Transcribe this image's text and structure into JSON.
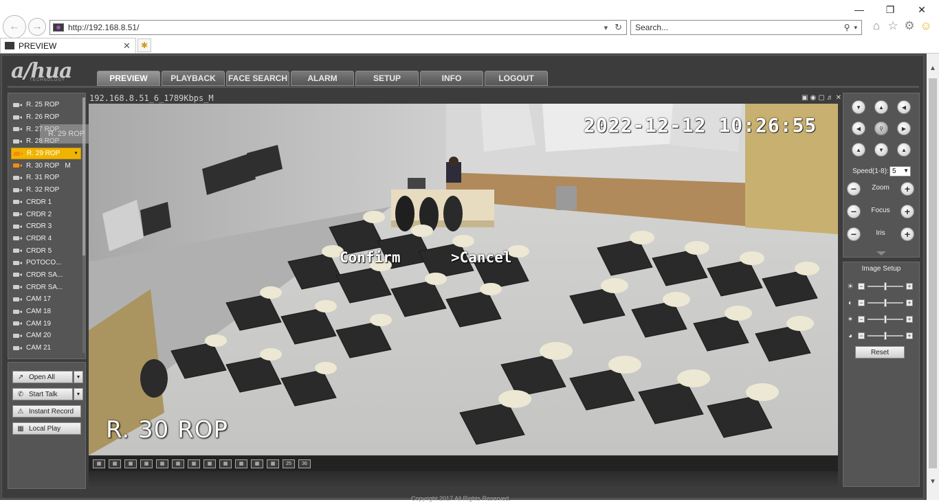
{
  "browser": {
    "address": "http://192.168.8.51/",
    "search_placeholder": "Search...",
    "tab_title": "PREVIEW"
  },
  "app": {
    "logo": "a/hua",
    "logo_sub": "TECHNOLOGY",
    "nav": [
      "PREVIEW",
      "PLAYBACK",
      "FACE SEARCH",
      "ALARM",
      "SETUP",
      "INFO",
      "LOGOUT"
    ],
    "active_nav": "PREVIEW"
  },
  "cameras": [
    {
      "label": "R. 25 ROP",
      "state": "normal"
    },
    {
      "label": "R. 26 ROP",
      "state": "normal"
    },
    {
      "label": "R. 27 ROP",
      "state": "normal"
    },
    {
      "label": "R. 28 ROP",
      "state": "normal"
    },
    {
      "label": "R. 29 ROP",
      "state": "selected"
    },
    {
      "label": "R. 30 ROP",
      "state": "active",
      "flag": "M"
    },
    {
      "label": "R. 31 ROP",
      "state": "normal"
    },
    {
      "label": "R. 32 ROP",
      "state": "normal"
    },
    {
      "label": "CRDR 1",
      "state": "normal"
    },
    {
      "label": "CRDR 2",
      "state": "normal"
    },
    {
      "label": "CRDR 3",
      "state": "normal"
    },
    {
      "label": "CRDR 4",
      "state": "normal"
    },
    {
      "label": "CRDR 5",
      "state": "normal"
    },
    {
      "label": "POTOCO...",
      "state": "normal"
    },
    {
      "label": "CRDR SA...",
      "state": "normal"
    },
    {
      "label": "CRDR SA...",
      "state": "normal"
    },
    {
      "label": "CAM 17",
      "state": "normal"
    },
    {
      "label": "CAM 18",
      "state": "normal"
    },
    {
      "label": "CAM 19",
      "state": "normal"
    },
    {
      "label": "CAM 20",
      "state": "normal"
    },
    {
      "label": "CAM 21",
      "state": "normal"
    }
  ],
  "drag_ghost": "R. 29 ROP",
  "actions": {
    "open_all": "Open All",
    "start_talk": "Start Talk",
    "instant_record": "Instant Record",
    "local_play": "Local Play"
  },
  "video": {
    "title": "192.168.8.51_6_1789Kbps_M",
    "osd_time": "2022-12-12 10:26:55",
    "osd_confirm": "Confirm",
    "osd_cancel": ">Cancel",
    "osd_name": "R. 30 ROP"
  },
  "layouts": [
    "1",
    "2",
    "3",
    "4",
    "5",
    "6",
    "7",
    "8",
    "9",
    "10",
    "11",
    "12",
    "25",
    "36"
  ],
  "ptz": {
    "speed_label": "Speed(1-8):",
    "speed_value": "5",
    "zoom": "Zoom",
    "focus": "Focus",
    "iris": "Iris"
  },
  "image_setup": {
    "title": "Image Setup",
    "rows": [
      "brightness",
      "contrast",
      "saturation",
      "hue"
    ],
    "levels": [
      0.5,
      0.5,
      0.5,
      0.5
    ],
    "reset": "Reset"
  },
  "footer": "Copyright 2017 All Rights Reserved."
}
